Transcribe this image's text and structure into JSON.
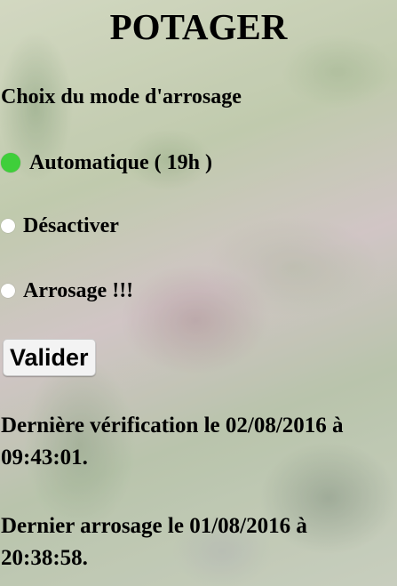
{
  "page": {
    "title": "POTAGER"
  },
  "form": {
    "heading": "Choix du mode d'arrosage",
    "options": [
      {
        "label": "Automatique ( 19h )",
        "selected": true
      },
      {
        "label": "Désactiver",
        "selected": false
      },
      {
        "label": "Arrosage !!!",
        "selected": false
      }
    ],
    "submit_label": "Valider"
  },
  "status": {
    "last_check": "Dernière vérification le 02/08/2016 à 09:43:01.",
    "last_watering": "Dernier arrosage le 01/08/2016 à 20:38:58."
  },
  "colors": {
    "selected_radio": "#3fcf3a",
    "unselected_radio": "#ffffff"
  }
}
